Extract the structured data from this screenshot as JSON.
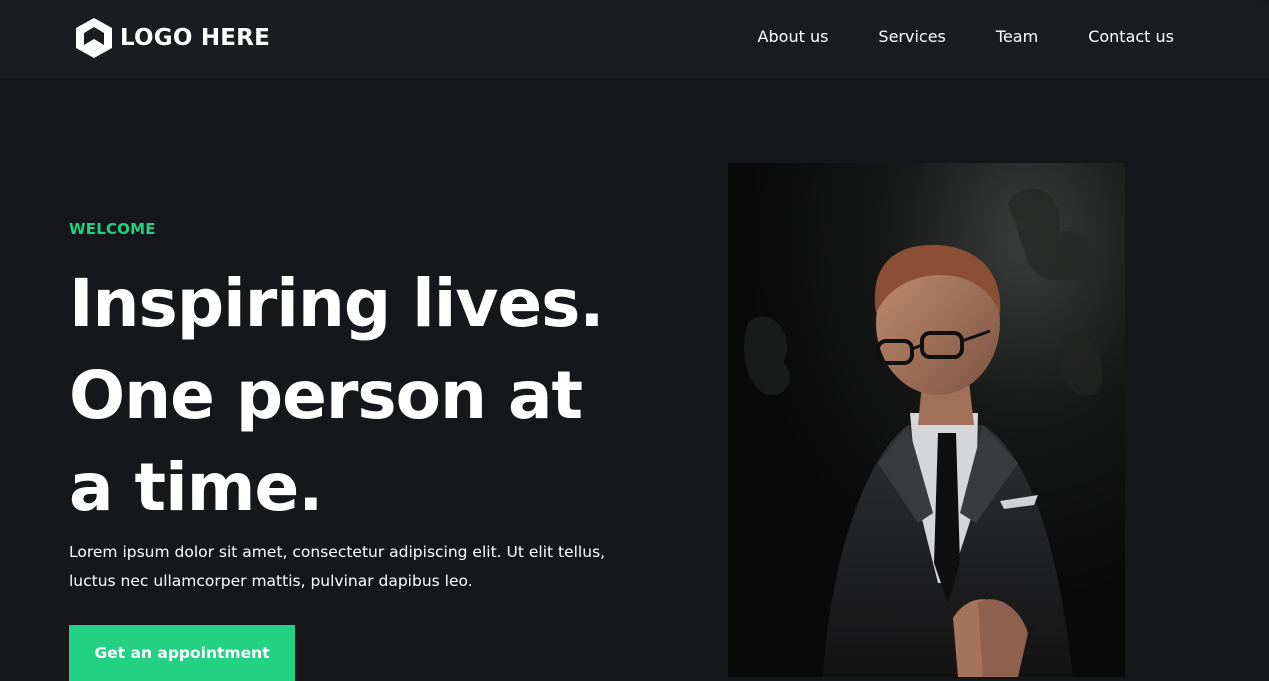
{
  "header": {
    "logo_text": "LOGO HERE",
    "logo_icon": "hexagon-cube-icon",
    "nav": [
      {
        "label": "About us"
      },
      {
        "label": "Services"
      },
      {
        "label": "Team"
      },
      {
        "label": "Contact us"
      }
    ]
  },
  "hero": {
    "eyebrow": "WELCOME",
    "headline_lines": [
      "Inspiring lives.",
      "One person at",
      "a time."
    ],
    "body": "Lorem ipsum dolor sit amet, consectetur adipiscing elit. Ut elit tellus, luctus nec ullamcorper mattis, pulvinar dapibus leo.",
    "cta_label": "Get an appointment"
  },
  "colors": {
    "background": "#16171a",
    "header_background": "#1b1c1f",
    "accent": "#22d184",
    "text": "#ffffff"
  }
}
